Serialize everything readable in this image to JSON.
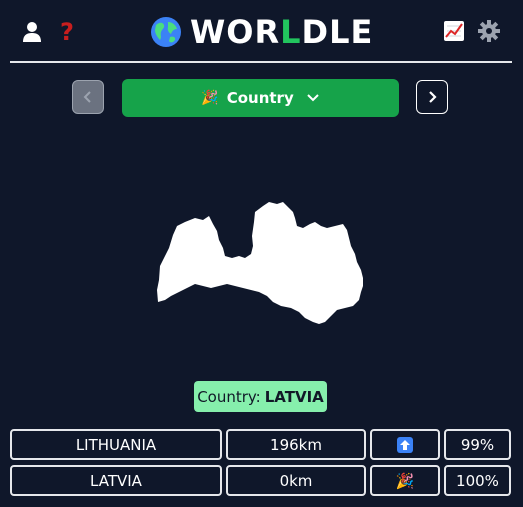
{
  "header": {
    "logo_text_1": "WOR",
    "logo_text_2": "L",
    "logo_text_3": "DLE",
    "help_symbol": "?"
  },
  "controls": {
    "mode_label": "Country",
    "mode_icon": "🎉"
  },
  "answer": {
    "prefix": "Country:",
    "value": "LATVIA"
  },
  "guesses": [
    {
      "country": "LITHUANIA",
      "distance": "196km",
      "direction": "arrow-up-icon",
      "proximity": "99%"
    },
    {
      "country": "LATVIA",
      "distance": "0km",
      "direction": "🎉",
      "proximity": "100%"
    }
  ],
  "colors": {
    "background": "#0f172a",
    "primary_green": "#16a34a",
    "answer_bg": "#86efac",
    "help_red": "#c81e1e",
    "arrow_blue": "#3b82f6"
  }
}
